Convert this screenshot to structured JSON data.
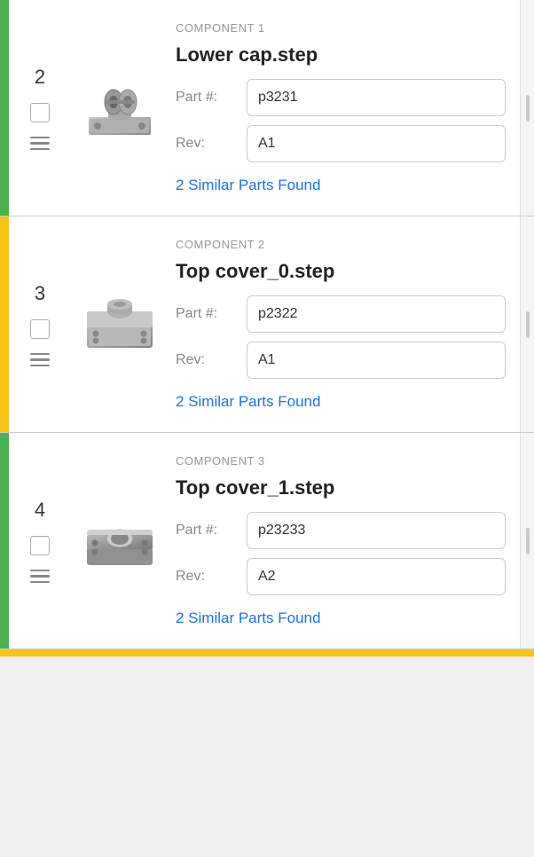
{
  "components": [
    {
      "id": "component-1",
      "row_number": "2",
      "bar_color": "green",
      "label": "COMPONENT 1",
      "name": "Lower cap.step",
      "part_number": "p3231",
      "rev": "A1",
      "similar_parts_text": "2 Similar Parts Found",
      "thumbnail_type": "lower-cap"
    },
    {
      "id": "component-2",
      "row_number": "3",
      "bar_color": "yellow",
      "label": "COMPONENT 2",
      "name": "Top cover_0.step",
      "part_number": "p2322",
      "rev": "A1",
      "similar_parts_text": "2 Similar Parts Found",
      "thumbnail_type": "top-cover-0"
    },
    {
      "id": "component-3",
      "row_number": "4",
      "bar_color": "green",
      "label": "COMPONENT 3",
      "name": "Top cover_1.step",
      "part_number": "p23233",
      "rev": "A2",
      "similar_parts_text": "2 Similar Parts Found",
      "thumbnail_type": "top-cover-1"
    }
  ],
  "fields": {
    "part_number_label": "Part #:",
    "rev_label": "Rev:"
  }
}
